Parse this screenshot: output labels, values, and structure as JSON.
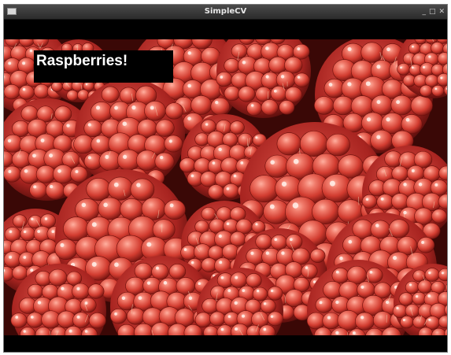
{
  "window": {
    "title": "SimpleCV",
    "controls": {
      "minimize": "_",
      "maximize": "□",
      "close": "✕"
    }
  },
  "image": {
    "subject": "raspberries",
    "overlay_text": "Raspberries!",
    "colors": {
      "berry_base": "#c8322a",
      "berry_highlight": "#f07a6a",
      "berry_shadow": "#5a0e0c",
      "overlay_background": "#000000",
      "overlay_text": "#ffffff"
    }
  }
}
